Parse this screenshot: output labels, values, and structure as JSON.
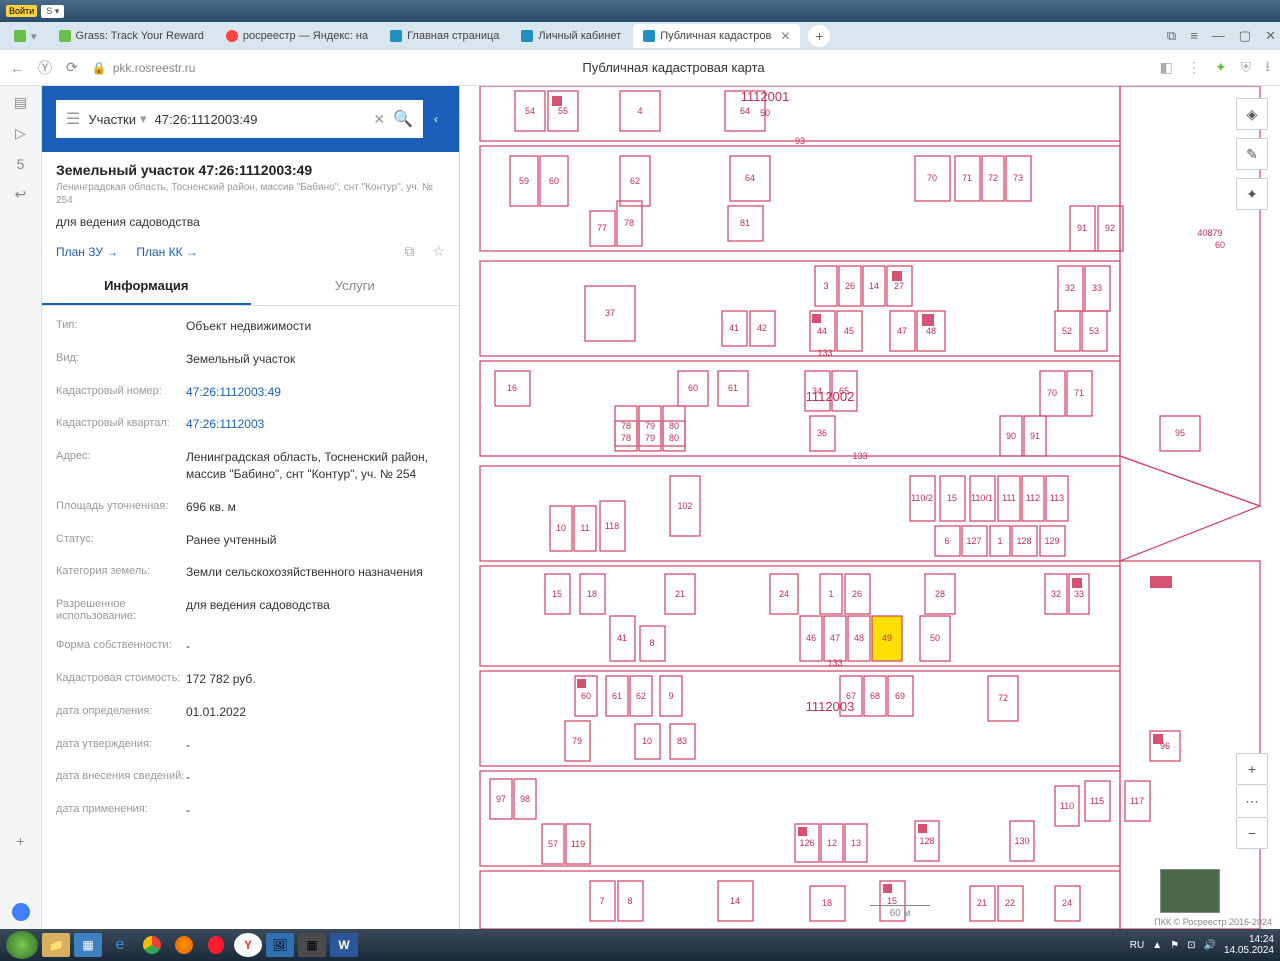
{
  "titlebar": {
    "login": "Войти"
  },
  "tabs": [
    {
      "label": "",
      "ico_bg": "#6abf4b"
    },
    {
      "label": "Grass: Track Your Reward",
      "ico_bg": "#6abf4b"
    },
    {
      "label": "росреестр — Яндекс: на",
      "ico_bg": "#ff4040"
    },
    {
      "label": "Главная страница",
      "ico_bg": "#2090c0"
    },
    {
      "label": "Личный кабинет",
      "ico_bg": "#2090c0"
    },
    {
      "label": "Публичная кадастров",
      "ico_bg": "#2090c0",
      "active": true
    }
  ],
  "winbtns": {
    "copy": "⧉",
    "menu": "≡",
    "min": "—",
    "max": "▢",
    "close": "✕"
  },
  "addr": {
    "url_host": "pkk.rosreestr.ru",
    "page_title": "Публичная кадастровая карта"
  },
  "search": {
    "selector": "Участки",
    "query": "47:26:1112003:49"
  },
  "object": {
    "title": "Земельный участок 47:26:1112003:49",
    "subtitle": "Ленинградская область, Тосненский район, массив \"Бабино\", снт \"Контур\", уч. № 254",
    "usage": "для ведения садоводства",
    "link_zu": "План ЗУ →",
    "link_kk": "План КК →"
  },
  "panel_tabs": {
    "info": "Информация",
    "services": "Услуги"
  },
  "info": [
    {
      "label": "Тип:",
      "value": "Объект недвижимости"
    },
    {
      "label": "Вид:",
      "value": "Земельный участок"
    },
    {
      "label": "Кадастровый номер:",
      "value": "47:26:1112003:49",
      "link": true
    },
    {
      "label": "Кадастровый квартал:",
      "value": "47:26:1112003",
      "link": true
    },
    {
      "label": "Адрес:",
      "value": "Ленинградская область, Тосненский район, массив \"Бабино\", снт \"Контур\", уч. № 254"
    },
    {
      "label": "Площадь уточненная:",
      "value": "696 кв. м"
    },
    {
      "label": "Статус:",
      "value": "Ранее учтенный"
    },
    {
      "label": "Категория земель:",
      "value": "Земли сельскохозяйственного назначения"
    },
    {
      "label": "Разрешенное использование:",
      "value": "для ведения садоводства"
    },
    {
      "label": "Форма собственности:",
      "value": "-"
    },
    {
      "label": "Кадастровая стоимость:",
      "value": "172 782 руб."
    },
    {
      "label": "дата определения:",
      "value": "01.01.2022"
    },
    {
      "label": "дата утверждения:",
      "value": "-"
    },
    {
      "label": "дата внесения сведений:",
      "value": "-"
    },
    {
      "label": "дата применения:",
      "value": "-"
    }
  ],
  "map": {
    "quarters": [
      "1112001",
      "1112002",
      "1112003"
    ],
    "attribution": "ПКК © Росреестр 2016-2024",
    "scale": "60 м",
    "coord_label": "40879\n60"
  },
  "tray": {
    "lang": "RU",
    "time": "14:24",
    "date": "14.05.2024"
  }
}
